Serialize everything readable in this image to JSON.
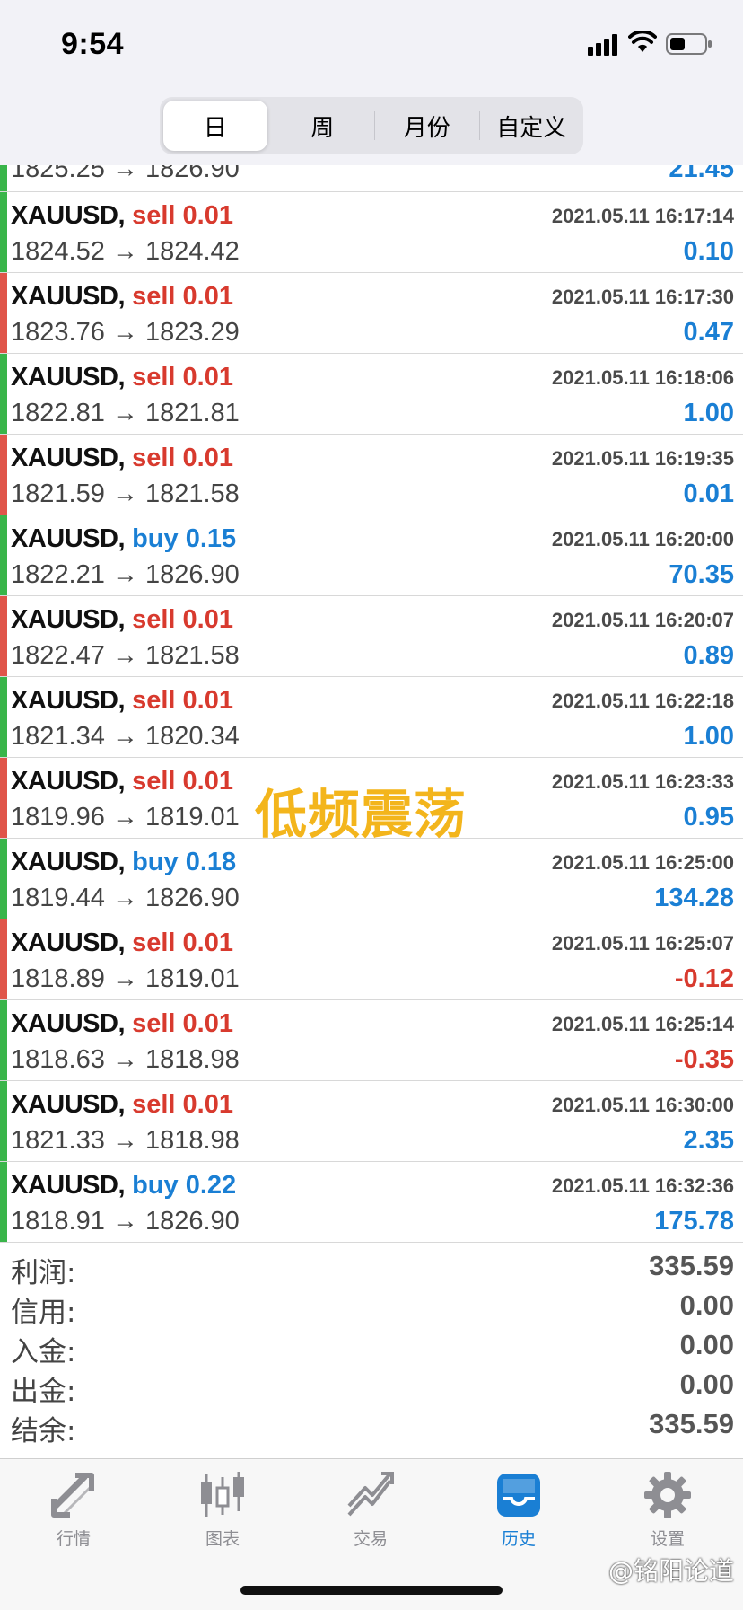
{
  "status": {
    "time": "9:54"
  },
  "period_tabs": [
    "日",
    "周",
    "月份",
    "自定义"
  ],
  "partial_row": {
    "prices": "1825.25 → 1826.90",
    "profit": "21.45"
  },
  "deals": [
    {
      "symbol": "XAUUSD,",
      "side": "sell",
      "volume": "0.01",
      "datetime": "2021.05.11 16:17:14",
      "prices": "1824.52 → 1824.42",
      "profit": "0.10"
    },
    {
      "symbol": "XAUUSD,",
      "side": "sell",
      "volume": "0.01",
      "datetime": "2021.05.11 16:17:30",
      "prices": "1823.76 → 1823.29",
      "profit": "0.47"
    },
    {
      "symbol": "XAUUSD,",
      "side": "sell",
      "volume": "0.01",
      "datetime": "2021.05.11 16:18:06",
      "prices": "1822.81 → 1821.81",
      "profit": "1.00"
    },
    {
      "symbol": "XAUUSD,",
      "side": "sell",
      "volume": "0.01",
      "datetime": "2021.05.11 16:19:35",
      "prices": "1821.59 → 1821.58",
      "profit": "0.01"
    },
    {
      "symbol": "XAUUSD,",
      "side": "buy",
      "volume": "0.15",
      "datetime": "2021.05.11 16:20:00",
      "prices": "1822.21 → 1826.90",
      "profit": "70.35"
    },
    {
      "symbol": "XAUUSD,",
      "side": "sell",
      "volume": "0.01",
      "datetime": "2021.05.11 16:20:07",
      "prices": "1822.47 → 1821.58",
      "profit": "0.89"
    },
    {
      "symbol": "XAUUSD,",
      "side": "sell",
      "volume": "0.01",
      "datetime": "2021.05.11 16:22:18",
      "prices": "1821.34 → 1820.34",
      "profit": "1.00"
    },
    {
      "symbol": "XAUUSD,",
      "side": "sell",
      "volume": "0.01",
      "datetime": "2021.05.11 16:23:33",
      "prices": "1819.96 → 1819.01",
      "profit": "0.95"
    },
    {
      "symbol": "XAUUSD,",
      "side": "buy",
      "volume": "0.18",
      "datetime": "2021.05.11 16:25:00",
      "prices": "1819.44 → 1826.90",
      "profit": "134.28"
    },
    {
      "symbol": "XAUUSD,",
      "side": "sell",
      "volume": "0.01",
      "datetime": "2021.05.11 16:25:07",
      "prices": "1818.89 → 1819.01",
      "profit": "-0.12"
    },
    {
      "symbol": "XAUUSD,",
      "side": "sell",
      "volume": "0.01",
      "datetime": "2021.05.11 16:25:14",
      "prices": "1818.63 → 1818.98",
      "profit": "-0.35"
    },
    {
      "symbol": "XAUUSD,",
      "side": "sell",
      "volume": "0.01",
      "datetime": "2021.05.11 16:30:00",
      "prices": "1821.33 → 1818.98",
      "profit": "2.35"
    },
    {
      "symbol": "XAUUSD,",
      "side": "buy",
      "volume": "0.22",
      "datetime": "2021.05.11 16:32:36",
      "prices": "1818.91 → 1826.90",
      "profit": "175.78"
    }
  ],
  "watermark": "低频震荡",
  "summary": {
    "profit_label": "利润:",
    "profit_value": "335.59",
    "credit_label": "信用:",
    "credit_value": "0.00",
    "deposit_label": "入金:",
    "deposit_value": "0.00",
    "withdrawal_label": "出金:",
    "withdrawal_value": "0.00",
    "balance_label": "结余:",
    "balance_value": "335.59"
  },
  "tabbar": {
    "quotes": "行情",
    "charts": "图表",
    "trade": "交易",
    "history": "历史",
    "settings": "设置"
  },
  "credit_text": "@铭阳论道",
  "colors": {
    "buy": "#1a7fd4",
    "sell": "#d83a2e",
    "accent": "#1a7fd4",
    "bar_green": "#39b54a",
    "bar_red": "#e0554a"
  }
}
